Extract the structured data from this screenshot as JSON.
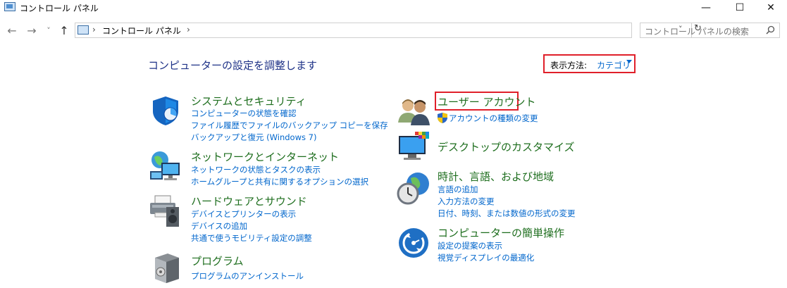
{
  "window": {
    "title": "コントロール パネル",
    "minimize_glyph": "—",
    "maximize_glyph": "☐",
    "close_glyph": "✕"
  },
  "nav": {
    "back": "←",
    "forward": "→",
    "recent": "˅",
    "up": "↑"
  },
  "address": {
    "crumb": "コントロール パネル",
    "separator": "›",
    "dropdown": "˅",
    "refresh": "↻"
  },
  "search": {
    "placeholder": "コントロール パネルの検索",
    "icon": "search-icon"
  },
  "main": {
    "heading": "コンピューターの設定を調整します",
    "view_by_label": "表示方法:",
    "view_by_value": "カテゴリ",
    "highlight_color": "#e0202a"
  },
  "categories_left": [
    {
      "title": "システムとセキュリティ",
      "icon": "shield-icon",
      "links": [
        "コンピューターの状態を確認",
        "ファイル履歴でファイルのバックアップ コピーを保存",
        "バックアップと復元 (Windows 7)"
      ]
    },
    {
      "title": "ネットワークとインターネット",
      "icon": "network-globe-icon",
      "links": [
        "ネットワークの状態とタスクの表示",
        "ホームグループと共有に関するオプションの選択"
      ]
    },
    {
      "title": "ハードウェアとサウンド",
      "icon": "printer-speaker-icon",
      "links": [
        "デバイスとプリンターの表示",
        "デバイスの追加",
        "共通で使うモビリティ設定の調整"
      ]
    },
    {
      "title": "プログラム",
      "icon": "program-box-icon",
      "links": [
        "プログラムのアンインストール"
      ]
    }
  ],
  "categories_right": [
    {
      "title": "ユーザー アカウント",
      "icon": "users-icon",
      "links": [
        "アカウントの種類の変更"
      ]
    },
    {
      "title": "デスクトップのカスタマイズ",
      "icon": "desktop-monitor-icon",
      "links": []
    },
    {
      "title": "時計、言語、および地域",
      "icon": "clock-globe-icon",
      "links": [
        "言語の追加",
        "入力方法の変更",
        "日付、時刻、または数値の形式の変更"
      ]
    },
    {
      "title": "コンピューターの簡単操作",
      "icon": "ease-of-access-icon",
      "links": [
        "設定の提案の表示",
        "視覚ディスプレイの最適化"
      ]
    }
  ]
}
